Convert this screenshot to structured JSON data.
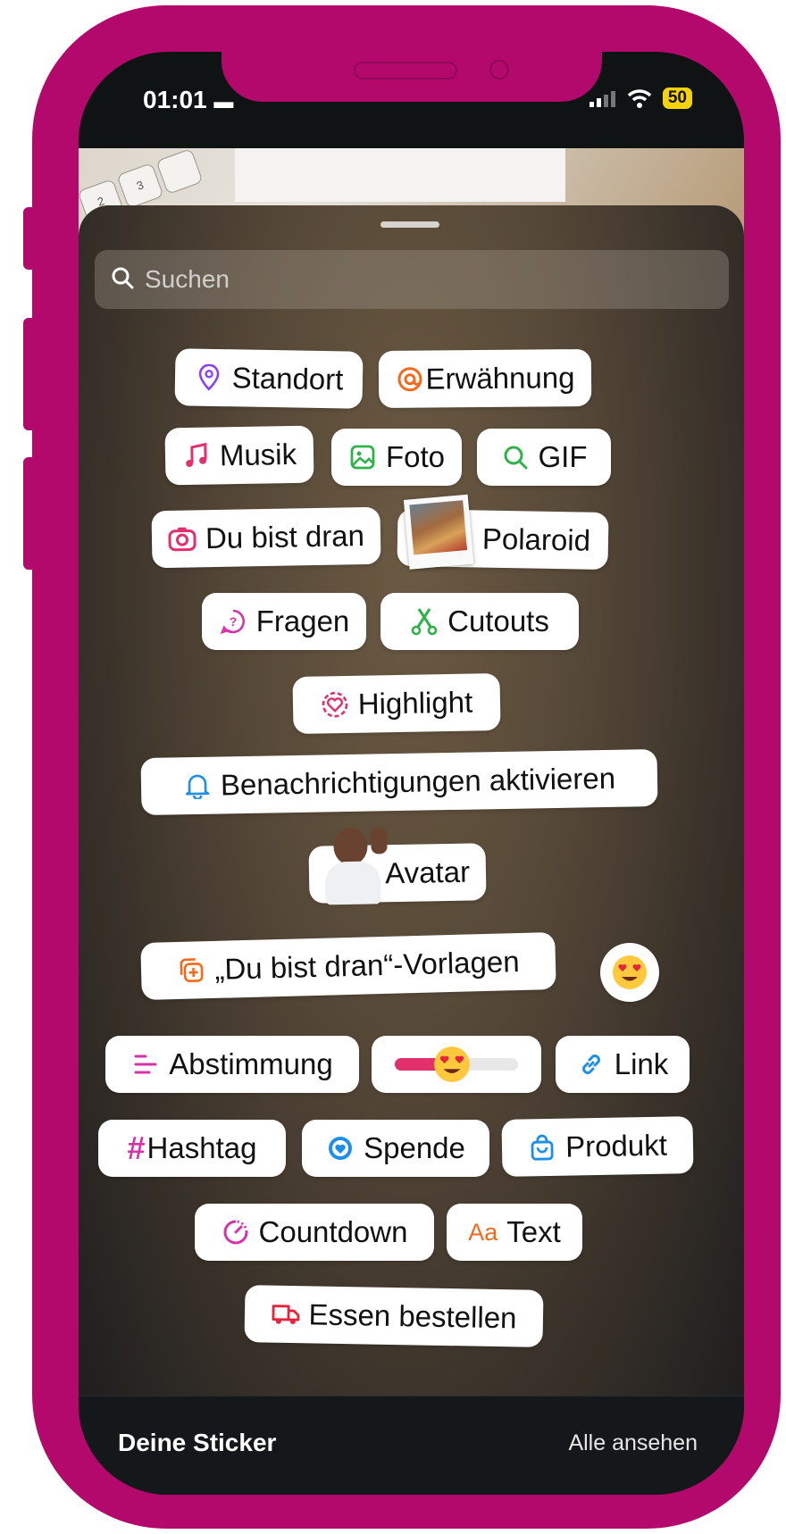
{
  "status": {
    "time": "01:01",
    "battery": "50"
  },
  "search": {
    "placeholder": "Suchen"
  },
  "stickers": {
    "standort": "Standort",
    "erwaehnung": "Erwähnung",
    "musik": "Musik",
    "foto": "Foto",
    "gif": "GIF",
    "du_bist_dran": "Du bist dran",
    "polaroid": "Polaroid",
    "fragen": "Fragen",
    "cutouts": "Cutouts",
    "highlight": "Highlight",
    "benachrichtigungen": "Benachrichtigungen aktivieren",
    "avatar": "Avatar",
    "vorlagen": "„Du bist dran“-Vorlagen",
    "abstimmung": "Abstimmung",
    "link": "Link",
    "hashtag": "Hashtag",
    "spende": "Spende",
    "produkt": "Produkt",
    "countdown": "Countdown",
    "text": "Text",
    "text_icon": "Aa",
    "essen": "Essen bestellen"
  },
  "footer": {
    "title": "Deine Sticker",
    "link": "Alle ansehen"
  },
  "colors": {
    "frame": "#b3096c",
    "brand_pink": "#e1306c"
  }
}
